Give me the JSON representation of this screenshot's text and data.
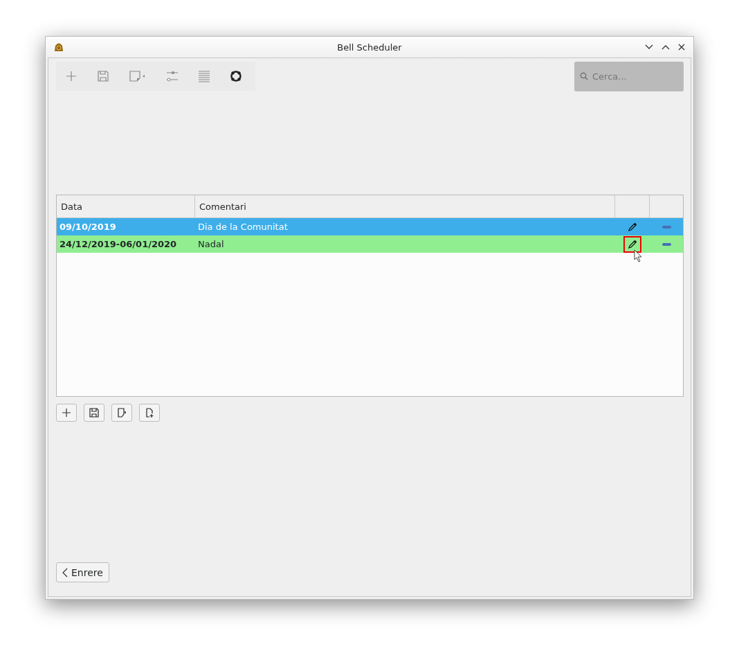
{
  "window": {
    "title": "Bell Scheduler"
  },
  "search": {
    "placeholder": "Cerca..."
  },
  "table": {
    "columns": [
      "Data",
      "Comentari"
    ],
    "rows": [
      {
        "date": "09/10/2019",
        "comment": "Dia de la Comunitat",
        "selected": true,
        "edit_focused": false
      },
      {
        "date": "24/12/2019-06/01/2020",
        "comment": "Nadal",
        "selected": false,
        "color": "#90ee90",
        "edit_focused": true
      }
    ]
  },
  "back_button": {
    "label": "Enrere"
  }
}
